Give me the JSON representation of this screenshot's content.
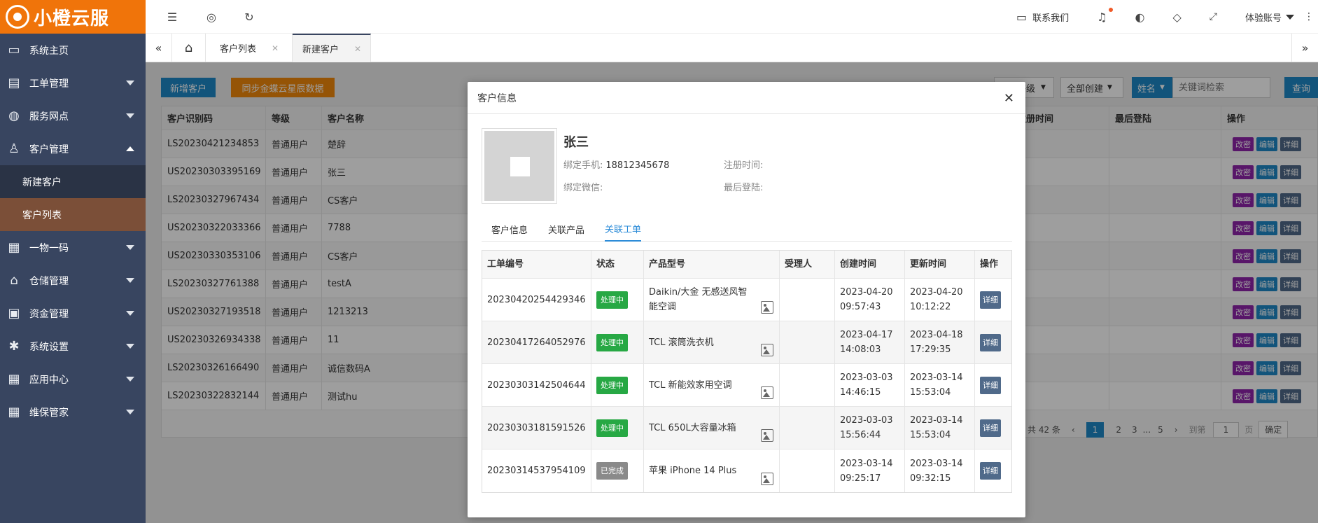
{
  "brand": {
    "name": "小橙云服"
  },
  "sidebar": {
    "items": [
      {
        "label": "系统主页",
        "icon": "monitor-icon"
      },
      {
        "label": "工单管理",
        "icon": "document-icon"
      },
      {
        "label": "服务网点",
        "icon": "globe-icon"
      },
      {
        "label": "客户管理",
        "icon": "user-icon"
      },
      {
        "label": "新建客户"
      },
      {
        "label": "客户列表"
      },
      {
        "label": "一物一码",
        "icon": "grid-icon"
      },
      {
        "label": "仓储管理",
        "icon": "bank-icon"
      },
      {
        "label": "资金管理",
        "icon": "money-icon"
      },
      {
        "label": "系统设置",
        "icon": "gear-icon"
      },
      {
        "label": "应用中心",
        "icon": "grid-icon"
      },
      {
        "label": "维保管家",
        "icon": "grid-icon"
      }
    ]
  },
  "topbar": {
    "contact": "联系我们",
    "account": "体验账号"
  },
  "tabs": [
    {
      "label": "客户列表"
    },
    {
      "label": "新建客户"
    }
  ],
  "toolbar": {
    "add_customer": "新增客户",
    "sync": "同步金蝶云星辰数据",
    "level_filter": "等级",
    "create_filter": "全部创建",
    "field_select": "姓名",
    "search_placeholder": "关键词检索",
    "search_button": "查询"
  },
  "customer_table": {
    "headers": [
      "客户识别码",
      "等级",
      "客户名称",
      "注册时间",
      "最后登陆",
      "操作"
    ],
    "rows": [
      {
        "id": "LS20230421234853",
        "level": "普通用户",
        "name": "楚辞"
      },
      {
        "id": "US20230303395169",
        "level": "普通用户",
        "name": "张三"
      },
      {
        "id": "LS20230327967434",
        "level": "普通用户",
        "name": "CS客户"
      },
      {
        "id": "US20230322033366",
        "level": "普通用户",
        "name": "7788"
      },
      {
        "id": "US20230330353106",
        "level": "普通用户",
        "name": "CS客户"
      },
      {
        "id": "LS20230327761388",
        "level": "普通用户",
        "name": "testA"
      },
      {
        "id": "US20230327193518",
        "level": "普通用户",
        "name": "1213213"
      },
      {
        "id": "US20230326934338",
        "level": "普通用户",
        "name": "11"
      },
      {
        "id": "LS20230326166490",
        "level": "普通用户",
        "name": "诚信数码A"
      },
      {
        "id": "LS20230322832144",
        "level": "普通用户",
        "name": "测试hu"
      }
    ],
    "actions": [
      "改密",
      "编辑",
      "详细"
    ]
  },
  "pagination": {
    "total": "共 42 条",
    "pages": [
      "1",
      "2",
      "3",
      "...",
      "5"
    ],
    "goto_label": "到第",
    "goto_value": "1",
    "page_unit": "页",
    "confirm": "确定"
  },
  "modal": {
    "title": "客户信息",
    "name": "张三",
    "phone_label": "绑定手机:",
    "phone": "18812345678",
    "wechat_label": "绑定微信:",
    "register_label": "注册时间:",
    "lastlogin_label": "最后登陆:",
    "tabs": [
      "客户信息",
      "关联产品",
      "关联工单"
    ],
    "active_tab": "关联工单",
    "orders": {
      "headers": [
        "工单编号",
        "状态",
        "产品型号",
        "受理人",
        "创建时间",
        "更新时间",
        "操作"
      ],
      "rows": [
        {
          "no": "20230420254429346",
          "status": "处理中",
          "product": "Daikin/大金 无感送风智能空调",
          "created_date": "2023-04-20",
          "created_time": "09:57:43",
          "updated_date": "2023-04-20",
          "updated_time": "10:12:22"
        },
        {
          "no": "20230417264052976",
          "status": "处理中",
          "product": "TCL 滚筒洗衣机",
          "created_date": "2023-04-17",
          "created_time": "14:08:03",
          "updated_date": "2023-04-18",
          "updated_time": "17:29:35"
        },
        {
          "no": "20230303142504644",
          "status": "处理中",
          "product": "TCL 新能效家用空调",
          "created_date": "2023-03-03",
          "created_time": "14:46:15",
          "updated_date": "2023-03-14",
          "updated_time": "15:53:04"
        },
        {
          "no": "20230303181591526",
          "status": "处理中",
          "product": "TCL 650L大容量冰箱",
          "created_date": "2023-03-03",
          "created_time": "15:56:44",
          "updated_date": "2023-03-14",
          "updated_time": "15:53:04"
        },
        {
          "no": "20230314537954109",
          "status": "已完成",
          "product": "苹果 iPhone 14 Plus",
          "created_date": "2023-03-14",
          "created_time": "09:25:17",
          "updated_date": "2023-03-14",
          "updated_time": "09:32:15"
        }
      ],
      "detail_label": "详细"
    }
  },
  "colors": {
    "brand": "#f0740a",
    "sidebar": "#384560",
    "primary": "#1e88c7",
    "warning": "#f0880a",
    "purple": "#8e24aa",
    "processing": "#27a844",
    "done": "#8a8a8a"
  }
}
